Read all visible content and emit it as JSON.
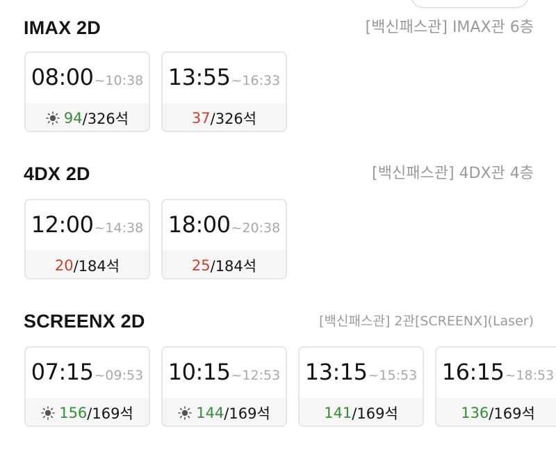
{
  "sections": [
    {
      "title": "IMAX 2D",
      "theater": "[백신패스관] IMAX관 6층",
      "showtimes": [
        {
          "start": "08:00",
          "end": "~10:38",
          "icon": "sun-icon",
          "available": "94",
          "total": "/326석",
          "status": "green"
        },
        {
          "start": "13:55",
          "end": "~16:33",
          "icon": null,
          "available": "37",
          "total": "/326석",
          "status": "red"
        }
      ]
    },
    {
      "title": "4DX 2D",
      "theater": "[백신패스관] 4DX관 4층",
      "showtimes": [
        {
          "start": "12:00",
          "end": "~14:38",
          "icon": null,
          "available": "20",
          "total": "/184석",
          "status": "red"
        },
        {
          "start": "18:00",
          "end": "~20:38",
          "icon": null,
          "available": "25",
          "total": "/184석",
          "status": "red"
        }
      ]
    },
    {
      "title": "SCREENX 2D",
      "theater": "[백신패스관] 2관[SCREENX](Laser)",
      "showtimes": [
        {
          "start": "07:15",
          "end": "~09:53",
          "icon": "sun-icon",
          "available": "156",
          "total": "/169석",
          "status": "green"
        },
        {
          "start": "10:15",
          "end": "~12:53",
          "icon": "sun-icon",
          "available": "144",
          "total": "/169석",
          "status": "green"
        },
        {
          "start": "13:15",
          "end": "~15:53",
          "icon": null,
          "available": "141",
          "total": "/169석",
          "status": "green"
        },
        {
          "start": "16:15",
          "end": "~18:53",
          "icon": null,
          "available": "136",
          "total": "/169석",
          "status": "green"
        }
      ]
    }
  ],
  "colors": {
    "available_green": "#3a8a3a",
    "available_red": "#c8412f",
    "theater_gray": "#9a9a9a",
    "end_time_gray": "#a8a8a8",
    "card_border": "#e6e6e6",
    "seat_bg": "#f6f6f6"
  }
}
